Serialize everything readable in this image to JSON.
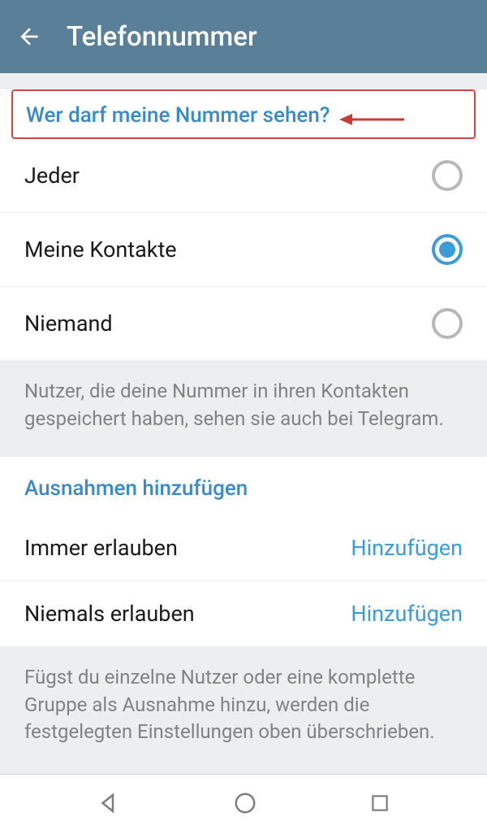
{
  "header": {
    "title": "Telefonnummer"
  },
  "visibility": {
    "section_title": "Wer darf meine Nummer sehen?",
    "options": [
      {
        "label": "Jeder",
        "selected": false
      },
      {
        "label": "Meine Kontakte",
        "selected": true
      },
      {
        "label": "Niemand",
        "selected": false
      }
    ],
    "info": "Nutzer, die deine Nummer in ihren Kontakten gespeichert haben, sehen sie auch bei Telegram."
  },
  "exceptions": {
    "section_title": "Ausnahmen hinzufügen",
    "rows": [
      {
        "label": "Immer erlauben",
        "action": "Hinzufügen"
      },
      {
        "label": "Niemals erlauben",
        "action": "Hinzufügen"
      }
    ],
    "info": "Fügst du einzelne Nutzer oder eine komplette Gruppe als Ausnahme hinzu, werden die festgelegten Einstellungen oben überschrieben."
  }
}
